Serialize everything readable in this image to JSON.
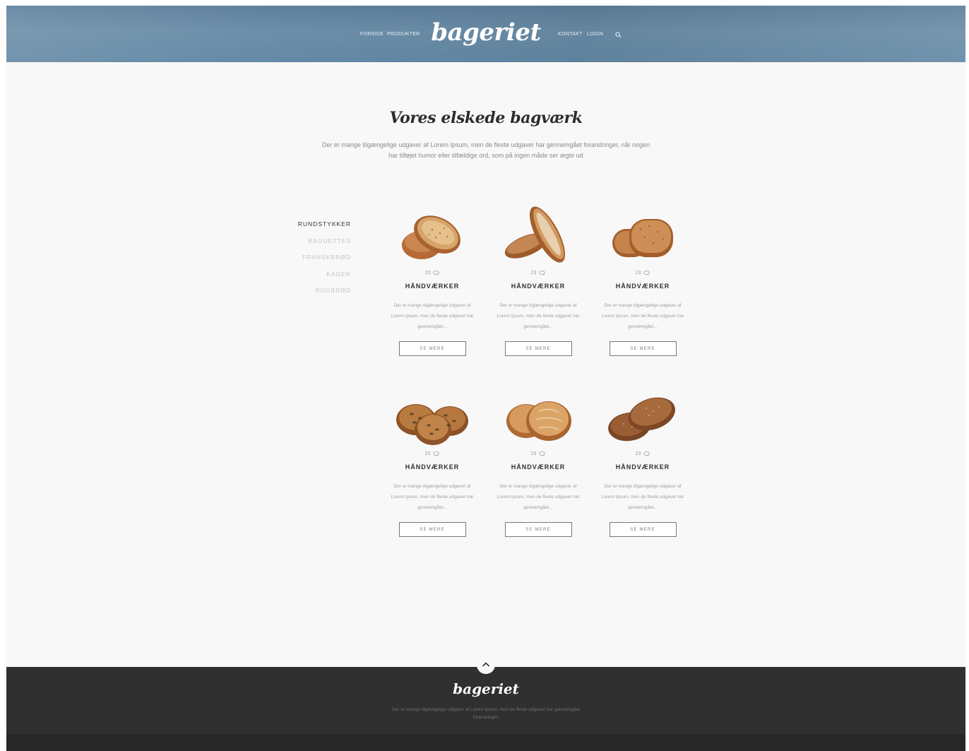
{
  "header": {
    "nav_left": [
      "FORSIDE",
      "PRODUKTER"
    ],
    "logo": "bageriet",
    "nav_right": [
      "KONTAKT",
      "LOGIN"
    ],
    "search_icon": "search-icon"
  },
  "intro": {
    "title": "Vores elskede bagværk",
    "text": "Der er mange tilgængelige udgaver af Lorem Ipsum, men de fleste udgaver har gennemgået forandringer, når nogen har tilføjet humor eller tilfældige ord, som på ingen måde ser ægte ud"
  },
  "categories": {
    "items": [
      "RUNDSTYKKER",
      "BAGUETTES",
      "FRANSKBRØD",
      "KAGER",
      "RUGBRØD"
    ],
    "active": "RUNDSTYKKER"
  },
  "products": [
    {
      "count": "23",
      "title": "HÅNDVÆRKER",
      "desc": "Der er mange tilgængelige udgaver af Lorem Ipsum, men de fleste udgaver har gennemgået...",
      "button": "SE MERE"
    },
    {
      "count": "23",
      "title": "HÅNDVÆRKER",
      "desc": "Der er mange tilgængelige udgaver af Lorem Ipsum, men de fleste udgaver har gennemgået...",
      "button": "SE MERE"
    },
    {
      "count": "23",
      "title": "HÅNDVÆRKER",
      "desc": "Der er mange tilgængelige udgaver af Lorem Ipsum, men de fleste udgaver har gennemgået...",
      "button": "SE MERE"
    },
    {
      "count": "23",
      "title": "HÅNDVÆRKER",
      "desc": "Der er mange tilgængelige udgaver af Lorem Ipsum, men de fleste udgaver har gennemgået...",
      "button": "SE MERE"
    },
    {
      "count": "23",
      "title": "HÅNDVÆRKER",
      "desc": "Der er mange tilgængelige udgaver af Lorem Ipsum, men de fleste udgaver har gennemgået...",
      "button": "SE MERE"
    },
    {
      "count": "23",
      "title": "HÅNDVÆRKER",
      "desc": "Der er mange tilgængelige udgaver af Lorem Ipsum, men de fleste udgaver har gennemgået...",
      "button": "SE MERE"
    }
  ],
  "footer": {
    "logo": "bageriet",
    "text": "Der er mange tilgængelige udgaver af Lorem Ipsum, men de fleste udgaver har gennemgået forandringer.",
    "scroll_top_icon": "chevron-up-icon"
  },
  "colors": {
    "header_blue": "#6b8ea9",
    "footer_dark": "#303030",
    "page_bg": "#f8f8f8",
    "title_dark": "#2d2d2d"
  }
}
